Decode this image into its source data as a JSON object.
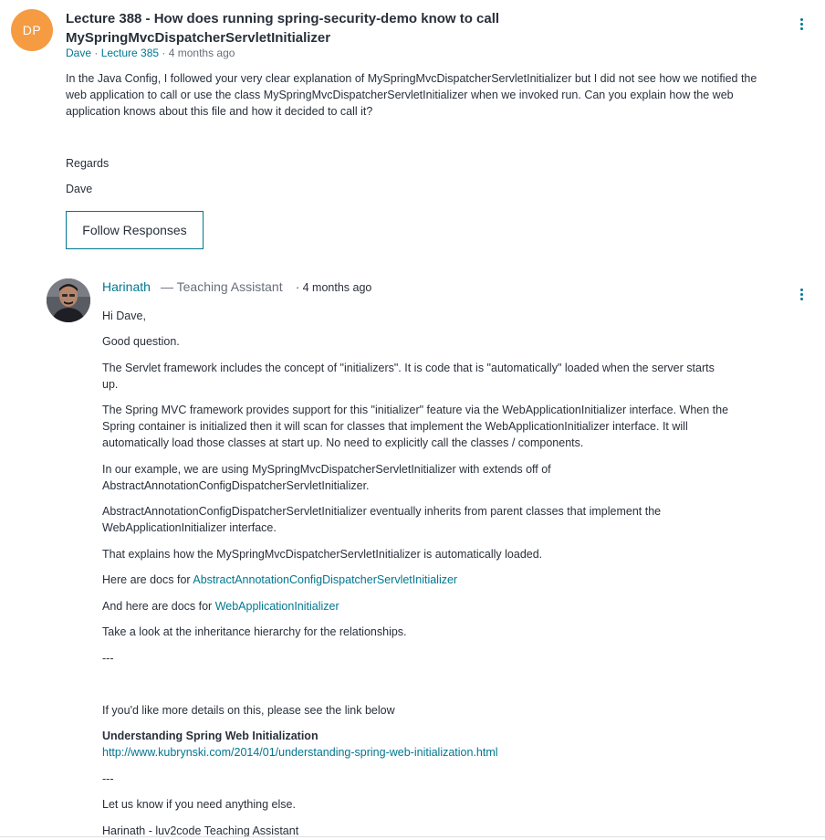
{
  "question": {
    "avatar_initials": "DP",
    "title_line1": "Lecture 388 - How does running spring-security-demo know to call",
    "title_line2": "MySpringMvcDispatcherServletInitializer",
    "author": "Dave",
    "meta_sep": " · ",
    "lecture": "Lecture 385",
    "time": " · 4 months ago",
    "body_lines": [
      "In the  Java Config, I followed your very clear explanation of MySpringMvcDispatcherServletInitializer but I did not see how we notified the",
      "web application to call or use the class MySpringMvcDispatcherServletInitializer when we invoked run. Can you explain how the web",
      "application knows about this file and how it decided to call it?"
    ],
    "regards": "Regards",
    "signature": "Dave",
    "follow_label": "Follow Responses"
  },
  "answer": {
    "name": "Harinath",
    "role": "— Teaching Assistant",
    "time": "· 4 months ago",
    "greeting": "Hi Dave,",
    "p1": "Good question.",
    "p2_lines": [
      "The Servlet framework includes the concept of \"initializers\". It is code that is \"automatically\" loaded when the server starts",
      "up."
    ],
    "p3_lines": [
      "The Spring MVC framework provides support for this \"initializer\" feature via the WebApplicationInitializer interface. When the",
      "Spring container is initialized then it will scan for classes that implement the WebApplicationInitializer interface. It will",
      "automatically load those classes at start up. No need to explicitly call the classes / components."
    ],
    "p4_lines": [
      "In our example, we are using MySpringMvcDispatcherServletInitializer with extends off of",
      "AbstractAnnotationConfigDispatcherServletInitializer."
    ],
    "p5_lines": [
      "AbstractAnnotationConfigDispatcherServletInitializer eventually inherits from parent classes that implement the",
      "WebApplicationInitializer interface."
    ],
    "p6": "That explains how the MySpringMvcDispatcherServletInitializer is automatically loaded.",
    "docs1_prefix": "Here are docs for ",
    "docs1_link": "AbstractAnnotationConfigDispatcherServletInitializer",
    "docs2_prefix": "And here are docs for ",
    "docs2_link": "WebApplicationInitializer",
    "p7": "Take a look at the inheritance hierarchy for the relationships.",
    "sep1": "---",
    "p8": "If you'd like more details on this, please see the link below",
    "ref_title": "Understanding Spring Web Initialization",
    "ref_url": "http://www.kubrynski.com/2014/01/understanding-spring-web-initialization.html",
    "sep2": "---",
    "p9": "Let us know if you need anything else.",
    "signoff": "Harinath - luv2code Teaching Assistant"
  }
}
